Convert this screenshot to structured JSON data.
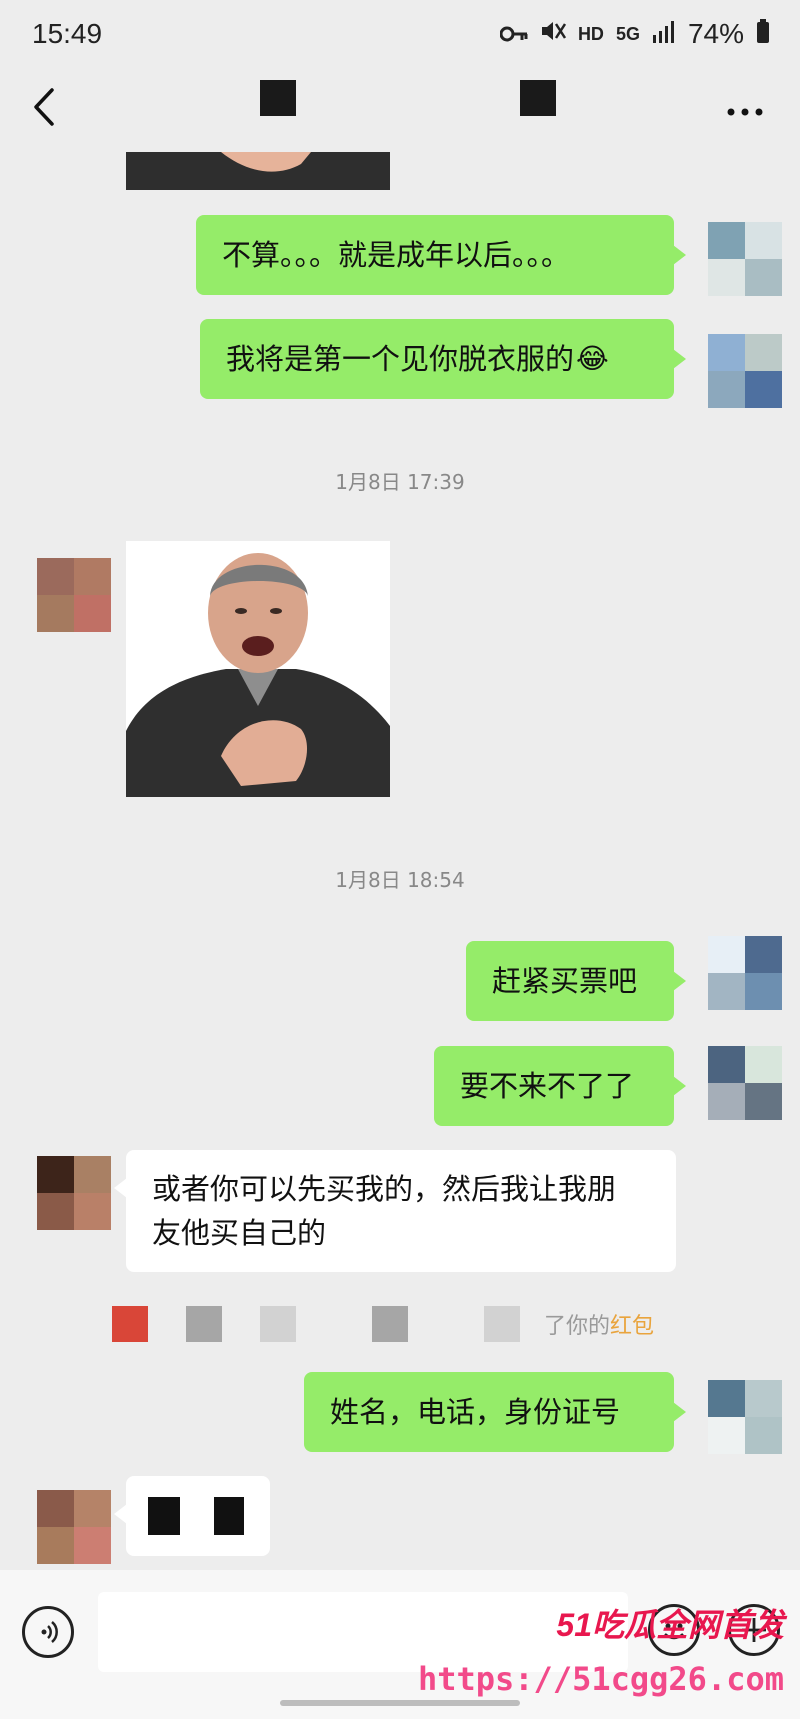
{
  "status_bar": {
    "time": "15:49",
    "icons": [
      "key-icon",
      "mute-icon",
      "hd-icon",
      "5g-icon",
      "signal-icon"
    ],
    "hd": "HD",
    "network": "5G",
    "battery": "74%"
  },
  "header": {
    "back_icon": "chevron-left-icon",
    "more_icon": "more-dots-icon"
  },
  "messages": [
    {
      "side": "me",
      "text": "不算。。。就是成年以后。。。"
    },
    {
      "side": "me",
      "text": "我将是第一个见你脱衣服的"
    },
    {
      "time": "1月8日 17:39"
    },
    {
      "side": "them",
      "type": "sticker"
    },
    {
      "time": "1月8日 18:54"
    },
    {
      "side": "me",
      "text": "赶紧买票吧"
    },
    {
      "side": "me",
      "text": "要不来不了了"
    },
    {
      "side": "them",
      "text_line1": "或者你可以先买我的，然后我让我朋",
      "text_line2": "友他买自己的"
    },
    {
      "system": "了你的",
      "system_red": "红包"
    },
    {
      "side": "me",
      "text": "姓名，电话，身份证号"
    }
  ],
  "emoji": "😂",
  "watermark": {
    "line1": "51吃瓜全网首发",
    "line2": "https://51cgg26.com"
  },
  "colors": {
    "me_bubble": "#95ec69",
    "them_bubble": "#ffffff",
    "background": "#ededed",
    "red_packet": "#e9a43d",
    "watermark_red": "#e8174e",
    "watermark_pink": "#f24a8a"
  }
}
